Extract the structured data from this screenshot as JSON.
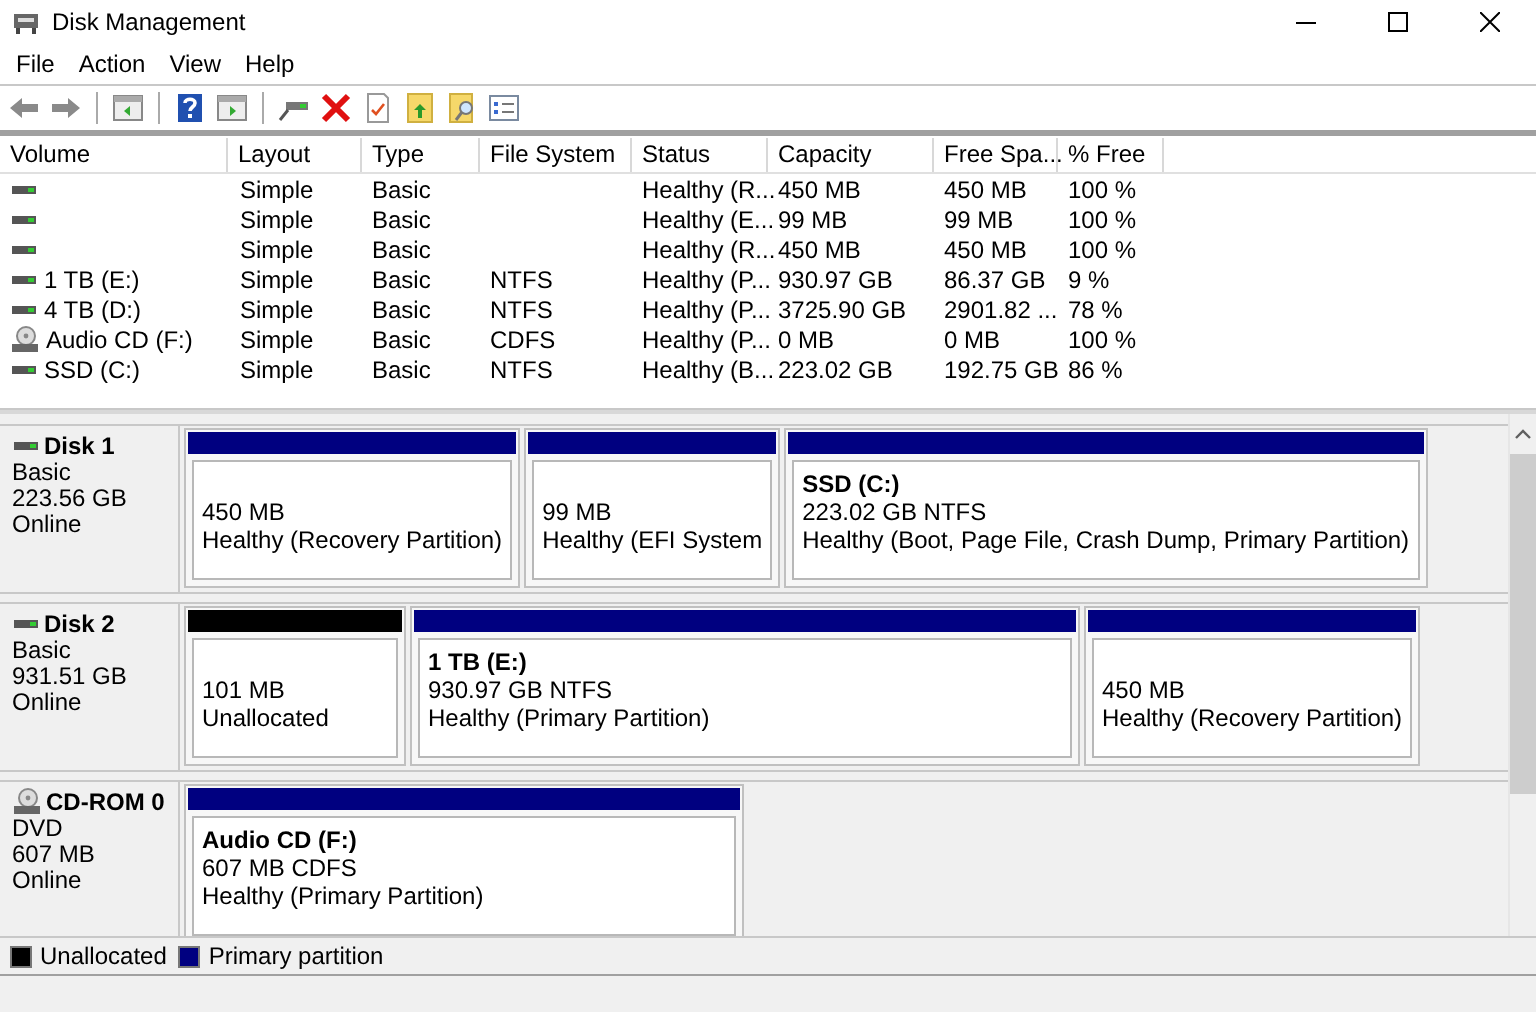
{
  "window": {
    "title": "Disk Management"
  },
  "menu": [
    "File",
    "Action",
    "View",
    "Help"
  ],
  "table": {
    "columns": [
      "Volume",
      "Layout",
      "Type",
      "File System",
      "Status",
      "Capacity",
      "Free Spa...",
      "% Free"
    ],
    "rows": [
      {
        "kind": "disk",
        "layout": "Simple",
        "type": "Basic",
        "status": "Healthy (R...",
        "capacity": "450 MB",
        "free_space": "450 MB",
        "percent_free": "100 %"
      },
      {
        "kind": "disk",
        "layout": "Simple",
        "type": "Basic",
        "status": "Healthy (E...",
        "capacity": "99 MB",
        "free_space": "99 MB",
        "percent_free": "100 %"
      },
      {
        "kind": "disk",
        "layout": "Simple",
        "type": "Basic",
        "status": "Healthy (R...",
        "capacity": "450 MB",
        "free_space": "450 MB",
        "percent_free": "100 %"
      },
      {
        "kind": "disk",
        "volume": "1 TB (E:)",
        "layout": "Simple",
        "type": "Basic",
        "file_system": "NTFS",
        "status": "Healthy (P...",
        "capacity": "930.97 GB",
        "free_space": "86.37 GB",
        "percent_free": "9 %"
      },
      {
        "kind": "disk",
        "volume": "4 TB (D:)",
        "layout": "Simple",
        "type": "Basic",
        "file_system": "NTFS",
        "status": "Healthy (P...",
        "capacity": "3725.90 GB",
        "free_space": "2901.82 ...",
        "percent_free": "78 %"
      },
      {
        "kind": "cd",
        "volume": "Audio CD (F:)",
        "layout": "Simple",
        "type": "Basic",
        "file_system": "CDFS",
        "status": "Healthy (P...",
        "capacity": "0 MB",
        "free_space": "0 MB",
        "percent_free": "100 %"
      },
      {
        "kind": "disk",
        "volume": "SSD (C:)",
        "layout": "Simple",
        "type": "Basic",
        "file_system": "NTFS",
        "status": "Healthy (B...",
        "capacity": "223.02 GB",
        "free_space": "192.75 GB",
        "percent_free": "86 %"
      }
    ]
  },
  "disks": [
    {
      "kind": "disk",
      "name": "Disk 1",
      "lines": [
        "Basic",
        "223.56 GB",
        "Online"
      ],
      "partitions": [
        {
          "kind": "primary",
          "lines": [
            "450 MB",
            "Healthy (Recovery Partition)"
          ]
        },
        {
          "kind": "primary",
          "lines": [
            "99 MB",
            "Healthy (EFI System"
          ]
        },
        {
          "kind": "primary",
          "name": "SSD  (C:)",
          "lines": [
            "223.02 GB NTFS",
            "Healthy (Boot, Page File, Crash Dump, Primary Partition)"
          ]
        }
      ]
    },
    {
      "kind": "disk",
      "name": "Disk 2",
      "lines": [
        "Basic",
        "931.51 GB",
        "Online"
      ],
      "partitions": [
        {
          "kind": "unallocated",
          "lines": [
            "101 MB",
            "Unallocated"
          ]
        },
        {
          "kind": "primary",
          "name": "1 TB  (E:)",
          "lines": [
            "930.97 GB NTFS",
            "Healthy (Primary Partition)"
          ]
        },
        {
          "kind": "primary",
          "lines": [
            "450 MB",
            "Healthy (Recovery Partition)"
          ]
        }
      ]
    },
    {
      "kind": "cd",
      "name": "CD-ROM 0",
      "lines": [
        "DVD",
        "607 MB",
        "Online"
      ],
      "partitions": [
        {
          "kind": "primary",
          "name": "Audio CD  (F:)",
          "lines": [
            "607 MB CDFS",
            "Healthy (Primary Partition)"
          ]
        }
      ]
    }
  ],
  "legend": [
    {
      "label": "Unallocated",
      "color": "#000000"
    },
    {
      "label": "Primary partition",
      "color": "#000080"
    }
  ]
}
